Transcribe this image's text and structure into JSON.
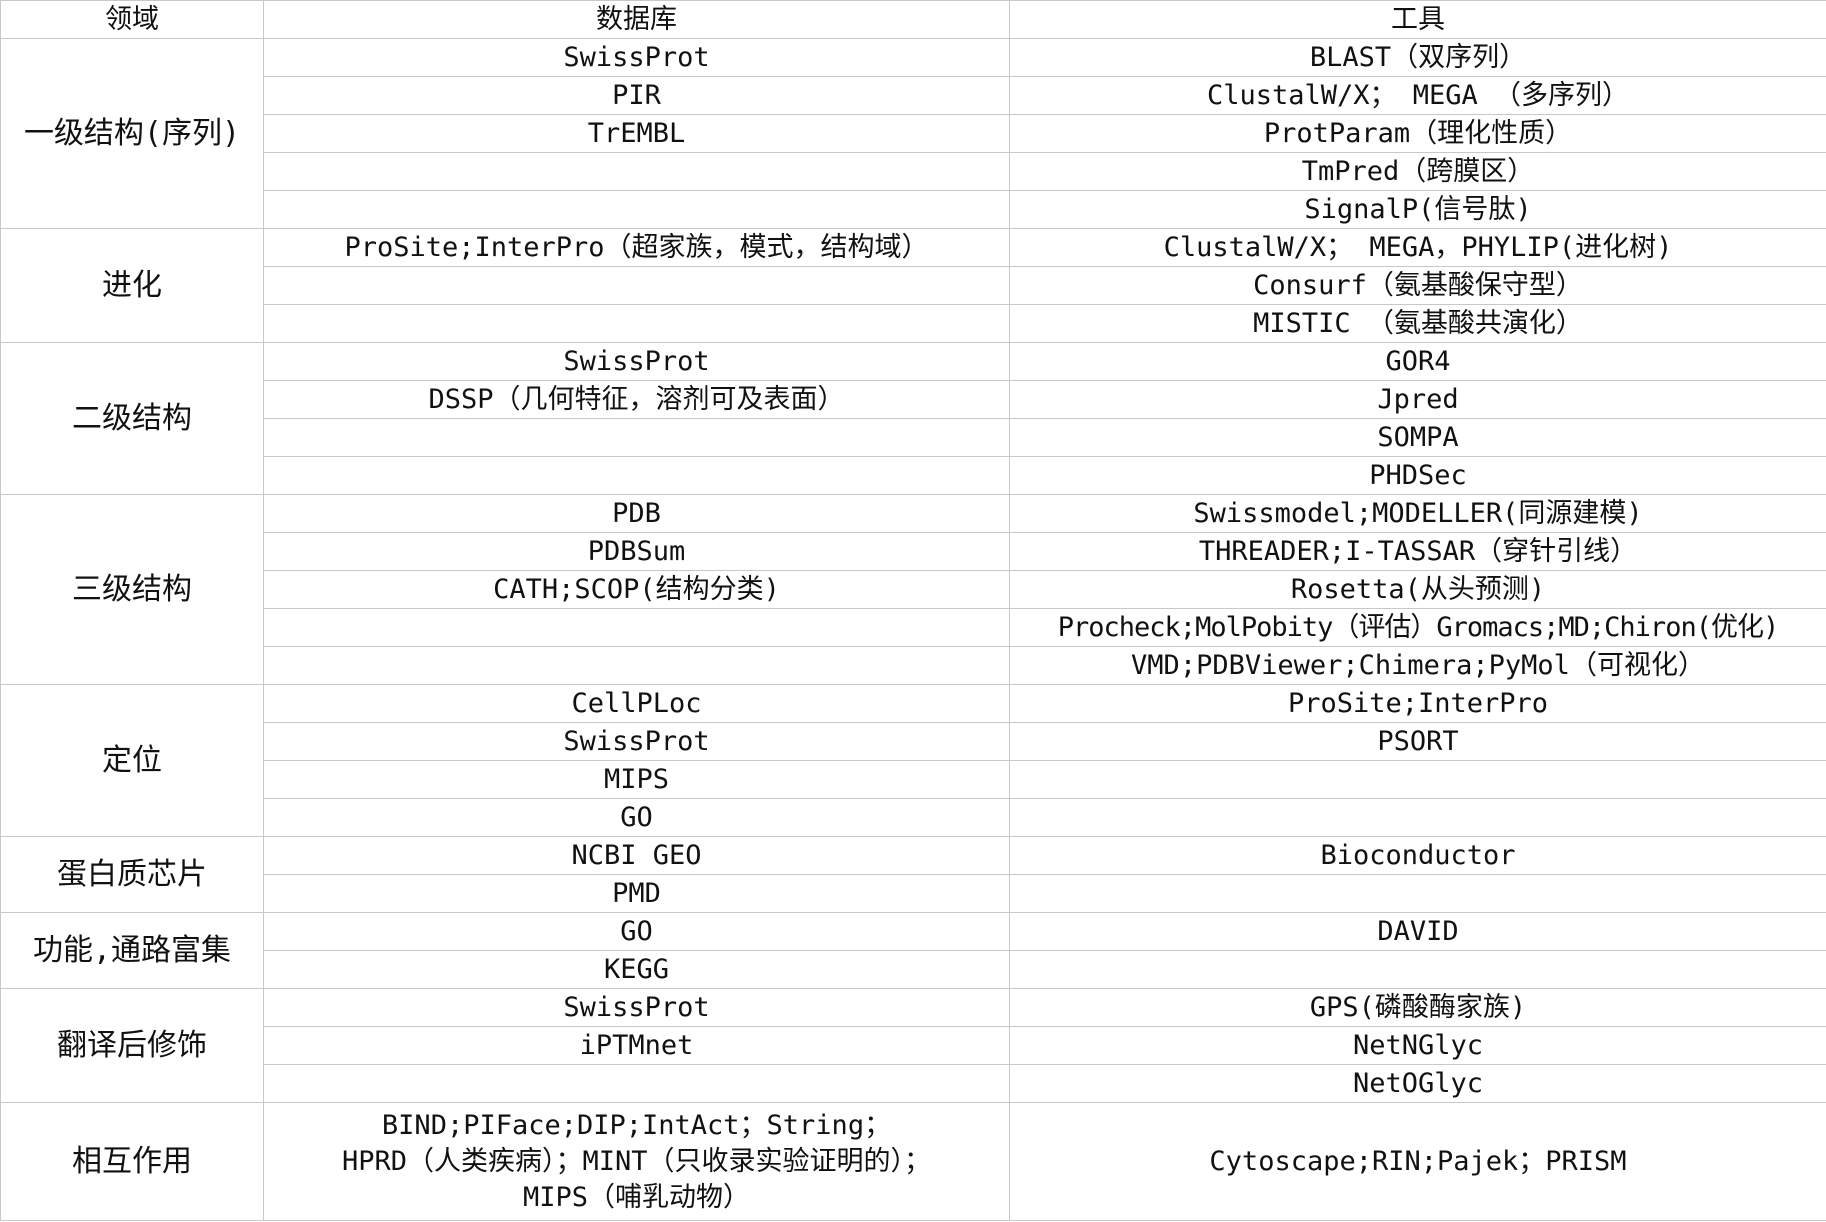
{
  "header": {
    "domain": "领域",
    "database": "数据库",
    "tool": "工具"
  },
  "groups": [
    {
      "domain": "一级结构(序列)",
      "rows": [
        {
          "db": "SwissProt",
          "tool": "BLAST（双序列）"
        },
        {
          "db": "PIR",
          "tool": "ClustalW/X； MEGA （多序列）"
        },
        {
          "db": "TrEMBL",
          "tool": "ProtParam（理化性质）"
        },
        {
          "db": "",
          "tool": "TmPred（跨膜区）"
        },
        {
          "db": "",
          "tool": "SignalP(信号肽)"
        }
      ]
    },
    {
      "domain": "进化",
      "rows": [
        {
          "db": "ProSite;InterPro（超家族，模式，结构域）",
          "tool": "ClustalW/X； MEGA，PHYLIP(进化树)"
        },
        {
          "db": "",
          "tool": "Consurf（氨基酸保守型）"
        },
        {
          "db": "",
          "tool": "MISTIC （氨基酸共演化）"
        }
      ]
    },
    {
      "domain": "二级结构",
      "rows": [
        {
          "db": "SwissProt",
          "tool": "GOR4"
        },
        {
          "db": "DSSP（几何特征，溶剂可及表面）",
          "tool": "Jpred"
        },
        {
          "db": "",
          "tool": "SOMPA"
        },
        {
          "db": "",
          "tool": "PHDSec"
        }
      ]
    },
    {
      "domain": "三级结构",
      "rows": [
        {
          "db": "PDB",
          "tool": "Swissmodel;MODELLER(同源建模)"
        },
        {
          "db": "PDBSum",
          "tool": "THREADER;I-TASSAR（穿针引线）"
        },
        {
          "db": "CATH;SCOP(结构分类)",
          "tool": "Rosetta(从头预测)"
        },
        {
          "db": "",
          "tool": "Procheck;MolPobity（评估）Gromacs;MD;Chiron(优化)"
        },
        {
          "db": "",
          "tool": "VMD;PDBViewer;Chimera;PyMol（可视化）"
        }
      ]
    },
    {
      "domain": "定位",
      "rows": [
        {
          "db": "CellPLoc",
          "tool": "ProSite;InterPro"
        },
        {
          "db": "SwissProt",
          "tool": "PSORT"
        },
        {
          "db": "MIPS",
          "tool": ""
        },
        {
          "db": "GO",
          "tool": ""
        }
      ]
    },
    {
      "domain": "蛋白质芯片",
      "rows": [
        {
          "db": "NCBI GEO",
          "tool": "Bioconductor"
        },
        {
          "db": "PMD",
          "tool": ""
        }
      ]
    },
    {
      "domain": "功能,通路富集",
      "rows": [
        {
          "db": "GO",
          "tool": "DAVID"
        },
        {
          "db": "KEGG",
          "tool": ""
        }
      ]
    },
    {
      "domain": "翻译后修饰",
      "rows": [
        {
          "db": "SwissProt",
          "tool": "GPS(磷酸酶家族)"
        },
        {
          "db": "iPTMnet",
          "tool": "NetNGlyc"
        },
        {
          "db": "",
          "tool": "NetOGlyc"
        }
      ]
    },
    {
      "domain": "相互作用",
      "rows": [
        {
          "db_lines": [
            "BIND;PIFace;DIP;IntAct；String；",
            "HPRD（人类疾病）；MINT（只收录实验证明的）；",
            "MIPS（哺乳动物）"
          ],
          "tool": "Cytoscape;RIN;Pajek；PRISM"
        }
      ]
    }
  ]
}
